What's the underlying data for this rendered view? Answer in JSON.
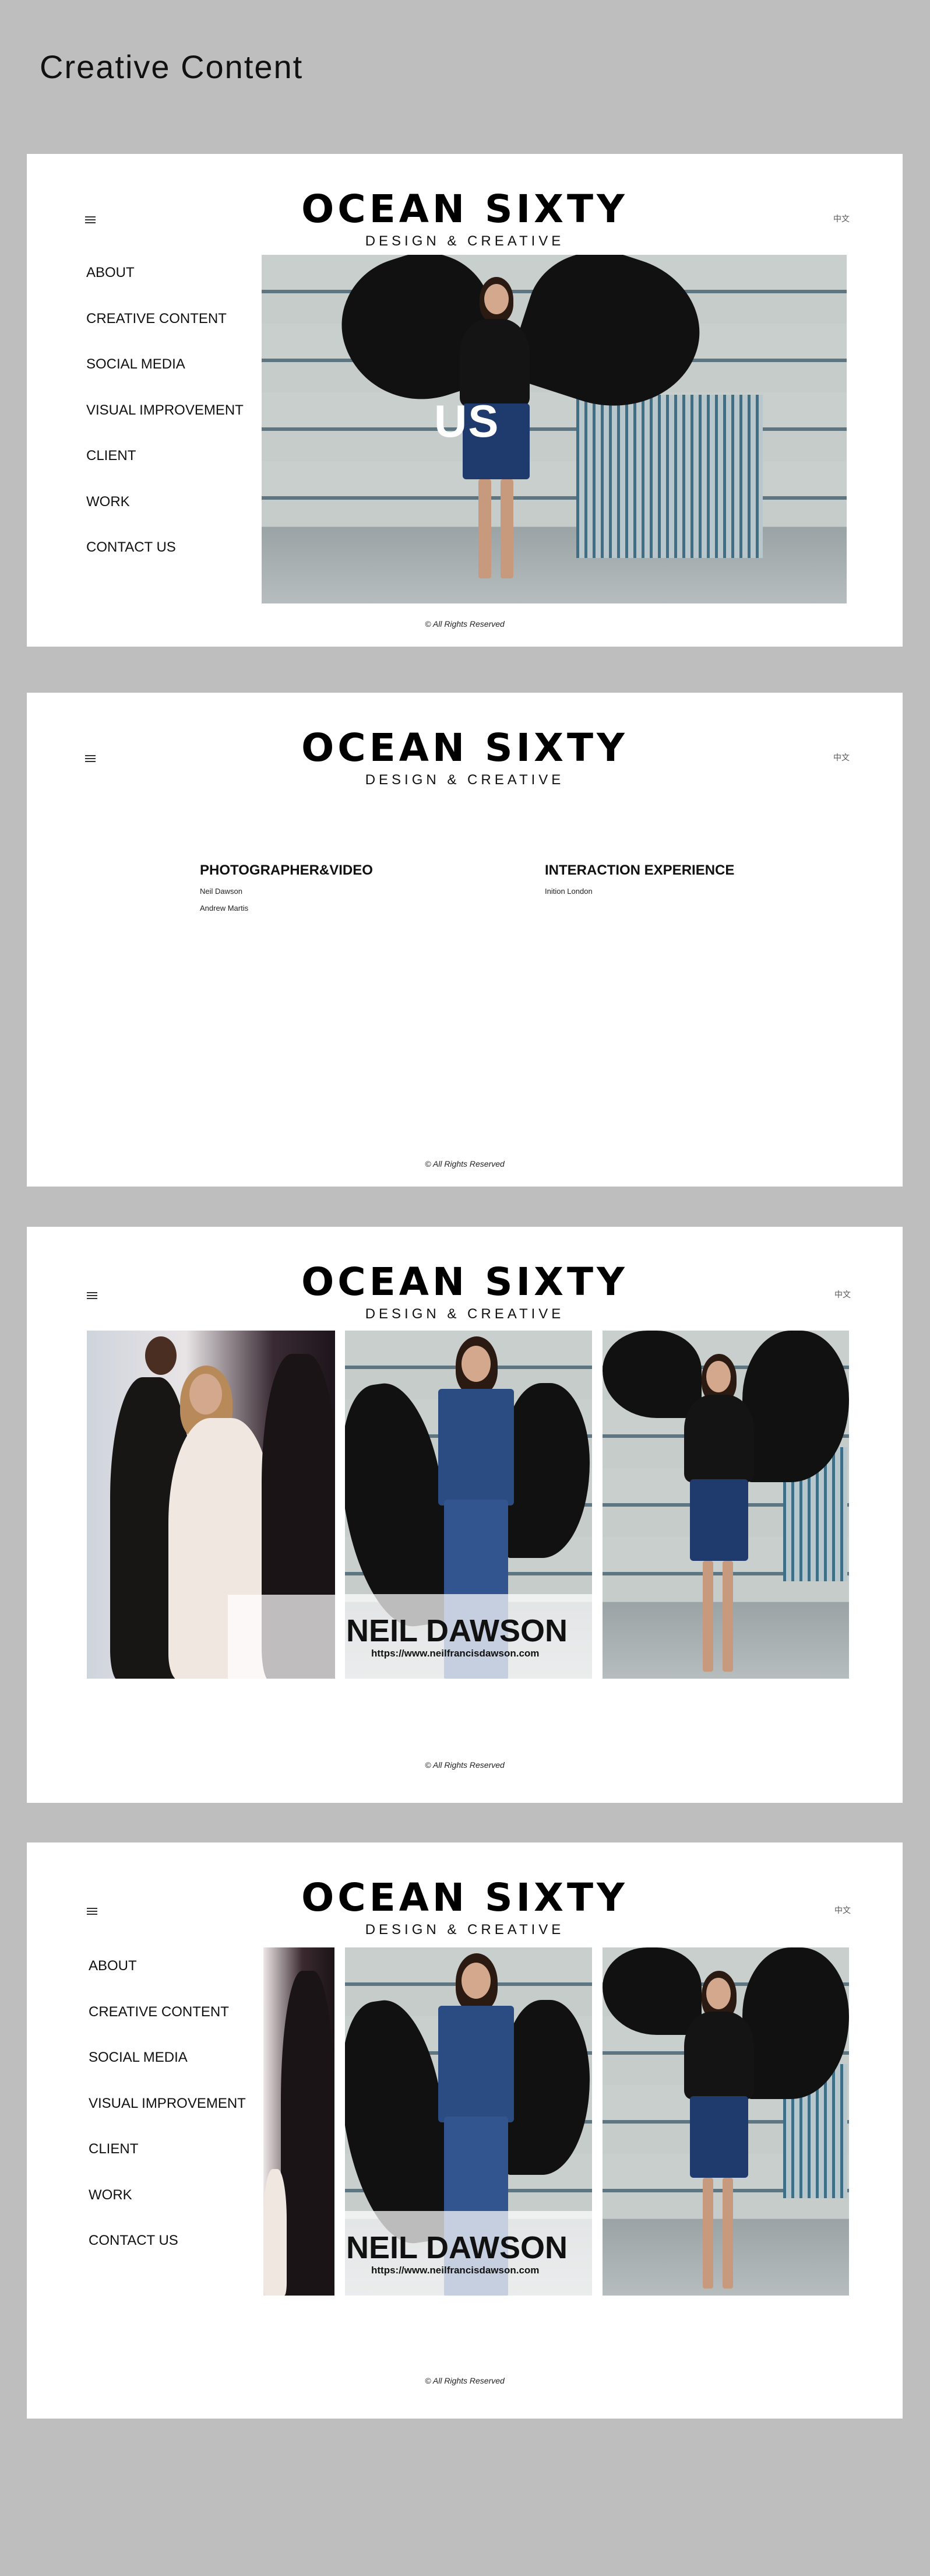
{
  "page": {
    "heading": "Creative Content"
  },
  "brand": {
    "title": "OCEAN SIXTY",
    "subtitle": "DESIGN & CREATIVE"
  },
  "lang_label": "中文",
  "nav": {
    "items": [
      "ABOUT",
      "CREATIVE CONTENT",
      "SOCIAL MEDIA",
      "VISUAL IMPROVEMENT",
      "CLIENT",
      "WORK",
      "CONTACT US"
    ]
  },
  "hero": {
    "overlay_text": "US"
  },
  "credits": {
    "columns": [
      {
        "title": "PHOTOGRAPHER&VIDEO",
        "names": [
          "Neil Dawson",
          "Andrew Martis"
        ]
      },
      {
        "title": "INTERACTION EXPERIENCE",
        "names": [
          "Inition London"
        ]
      }
    ]
  },
  "feature": {
    "name": "NEIL DAWSON",
    "url": "https://www.neilfrancisdawson.com"
  },
  "footer": {
    "text": "© All Rights Reserved"
  },
  "colors": {
    "background": "#bebebe",
    "panel": "#ffffff",
    "text": "#111111"
  },
  "icons": {
    "menu": "hamburger-icon"
  }
}
